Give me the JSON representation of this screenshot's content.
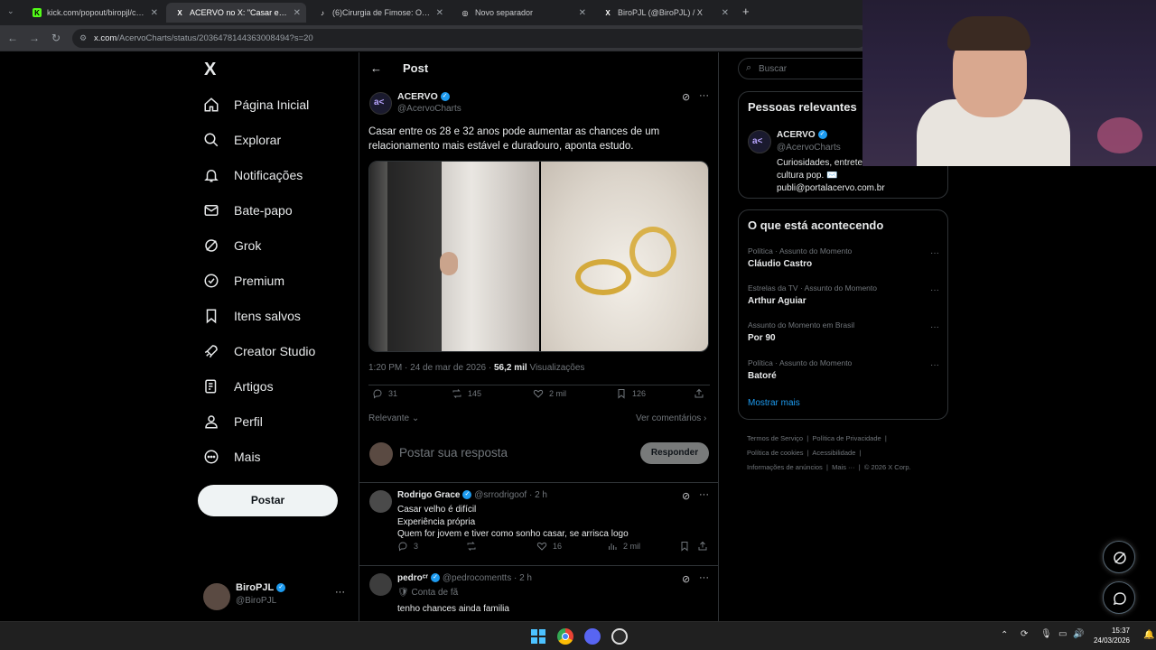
{
  "browser": {
    "tabs": [
      {
        "title": "kick.com/popout/biropjl/chat",
        "favicon": "K"
      },
      {
        "title": "ACERVO no X: \"Casar entre os 2",
        "favicon": "X"
      },
      {
        "title": "(6)Cirurgia de Fimose: O Erro e",
        "favicon": "♪"
      },
      {
        "title": "Novo separador",
        "favicon": "◎"
      },
      {
        "title": "BiroPJL (@BiroPJL) / X",
        "favicon": "X"
      }
    ],
    "url_host": "x.com",
    "url_path": "/AcervoCharts/status/2036478144363008494?s=20"
  },
  "nav": {
    "logo": "X",
    "items": [
      {
        "label": "Página Inicial",
        "icon": "home-icon"
      },
      {
        "label": "Explorar",
        "icon": "search-icon"
      },
      {
        "label": "Notificações",
        "icon": "bell-icon"
      },
      {
        "label": "Bate-papo",
        "icon": "mail-icon"
      },
      {
        "label": "Grok",
        "icon": "grok-icon"
      },
      {
        "label": "Premium",
        "icon": "premium-icon"
      },
      {
        "label": "Itens salvos",
        "icon": "bookmark-icon"
      },
      {
        "label": "Creator Studio",
        "icon": "rocket-icon"
      },
      {
        "label": "Artigos",
        "icon": "article-icon"
      },
      {
        "label": "Perfil",
        "icon": "person-icon"
      },
      {
        "label": "Mais",
        "icon": "more-circle-icon"
      }
    ],
    "post_button": "Postar",
    "profile": {
      "name": "BiroPJL",
      "handle": "@BiroPJL",
      "more": "···"
    }
  },
  "post": {
    "header_title": "Post",
    "author_name": "ACERVO",
    "author_handle": "@AcervoCharts",
    "text_line1": "Casar entre os 28 e 32 anos pode aumentar as chances de um",
    "text_line2": "relacionamento mais estável e duradouro, aponta estudo.",
    "time": "1:20 PM · 24 de mar de 2026 ·",
    "views_count": "56,2 mil",
    "views_label": "Visualizações",
    "replies": "31",
    "reposts": "145",
    "likes": "2 mil",
    "bookmarks": "126",
    "sort_label": "Relevante",
    "view_comments": "Ver comentários",
    "reply_placeholder": "Postar sua resposta",
    "reply_button": "Responder"
  },
  "replies": [
    {
      "name": "Rodrigo Grace",
      "handle": "@srrodrigoof",
      "time": "· 2 h",
      "lines": [
        "Casar velho é difícil",
        "Experiência própria",
        "Quem for jovem e tiver como sonho casar, se arrisca logo"
      ],
      "replies": "3",
      "likes": "16",
      "views": "2 mil"
    },
    {
      "name": "pedroᶜʳ",
      "handle": "@pedrocomentts",
      "time": "· 2 h",
      "badge": "Conta de fã",
      "lines": [
        "tenho chances ainda familia"
      ]
    }
  ],
  "search": {
    "placeholder": "Buscar"
  },
  "relevant": {
    "title": "Pessoas relevantes",
    "name": "ACERVO",
    "handle": "@AcervoCharts",
    "bio_line1": "Curiosidades, entrete",
    "bio_line2": "cultura pop. ✉️",
    "bio_line3": "publi@portalacervo.com.br"
  },
  "happening": {
    "title": "O que está acontecendo",
    "trends": [
      {
        "category": "Política · Assunto do Momento",
        "name": "Cláudio Castro"
      },
      {
        "category": "Estrelas da TV · Assunto do Momento",
        "name": "Arthur Aguiar"
      },
      {
        "category": "Assunto do Momento em Brasil",
        "name": "Por 90"
      },
      {
        "category": "Política · Assunto do Momento",
        "name": "Batoré"
      }
    ],
    "show_more": "Mostrar mais"
  },
  "footer": {
    "links1": [
      "Termos de Serviço",
      "Política de Privacidade"
    ],
    "links2": [
      "Política de cookies",
      "Acessibilidade"
    ],
    "links3": [
      "Informações de anúncios",
      "Mais ···",
      "© 2026 X Corp."
    ]
  },
  "taskbar": {
    "time": "15:37",
    "date": "24/03/2026"
  },
  "colors": {
    "accent": "#1d9bf0",
    "background": "#000000",
    "muted": "#71767b"
  }
}
